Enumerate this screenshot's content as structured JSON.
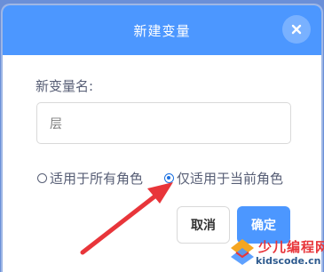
{
  "dialog": {
    "title": "新建变量",
    "close_icon": "close-icon"
  },
  "form": {
    "name_label": "新变量名:",
    "name_value": "层"
  },
  "scope": {
    "options": [
      {
        "label": "适用于所有角色",
        "checked": false
      },
      {
        "label": "仅适用于当前角色",
        "checked": true
      }
    ]
  },
  "buttons": {
    "cancel_label": "取消",
    "ok_label": "确定"
  },
  "watermark": {
    "title": "少儿编程网",
    "url": "kidscode.cn"
  },
  "colors": {
    "header": "#4c97ff",
    "ok_button": "#4c97ff",
    "annotation_arrow": "#e8353a"
  }
}
